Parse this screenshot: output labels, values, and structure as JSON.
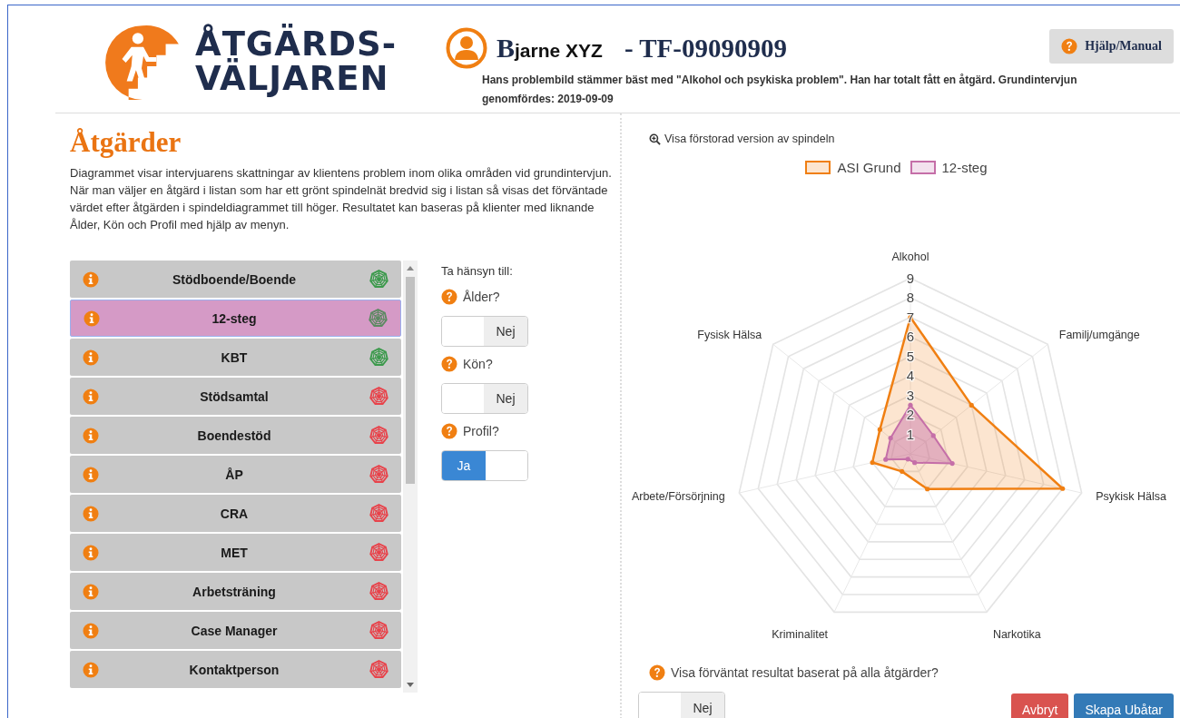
{
  "header": {
    "logo_lines": [
      "ÅTGÄRDS-",
      "VÄLJAREN"
    ],
    "client_name": "Bjarne XYZ",
    "client_id": "- TF-09090909",
    "summary": "Hans problembild stämmer bäst med \"Alkohol och psykiska problem\". Han har totalt fått en åtgärd. Grundintervjun genomfördes: 2019-09-09",
    "help_button": "Hjälp/Manual"
  },
  "main": {
    "title": "Åtgärder",
    "description": "Diagrammet visar intervjuarens skattningar av klientens problem inom olika områden vid grundintervjun. När man väljer en åtgärd i listan som har ett grönt spindelnät bredvid sig i listan så visas det förväntade värdet efter åtgärden i spindeldiagrammet till höger. Resultatet kan baseras på klienter med liknande Ålder, Kön och Profil med hjälp av menyn."
  },
  "measures": [
    {
      "label": "Stödboende/Boende",
      "selected": false,
      "color": "#3c9a4c"
    },
    {
      "label": "12-steg",
      "selected": true,
      "color": "#5c8a62"
    },
    {
      "label": "KBT",
      "selected": false,
      "color": "#3c9a4c"
    },
    {
      "label": "Stödsamtal",
      "selected": false,
      "color": "#e8434b"
    },
    {
      "label": "Boendestöd",
      "selected": false,
      "color": "#e8434b"
    },
    {
      "label": "ÅP",
      "selected": false,
      "color": "#e8434b"
    },
    {
      "label": "CRA",
      "selected": false,
      "color": "#e8434b"
    },
    {
      "label": "MET",
      "selected": false,
      "color": "#e8434b"
    },
    {
      "label": "Arbetsträning",
      "selected": false,
      "color": "#e8434b"
    },
    {
      "label": "Case Manager",
      "selected": false,
      "color": "#e8434b"
    },
    {
      "label": "Kontaktperson",
      "selected": false,
      "color": "#e8434b"
    }
  ],
  "filters": {
    "title": "Ta hänsyn till:",
    "items": [
      {
        "label": "Ålder?",
        "on": false,
        "value": "Nej"
      },
      {
        "label": "Kön?",
        "on": false,
        "value": "Nej"
      },
      {
        "label": "Profil?",
        "on": true,
        "value": "Ja"
      }
    ]
  },
  "spider": {
    "zoom_link": "Visa förstorad version av spindeln",
    "axes": [
      "Alkohol",
      "Familj/umgänge",
      "Psykisk Hälsa",
      "Narkotika",
      "Kriminalitet",
      "Arbete/Försörjning",
      "Fysisk Hälsa"
    ],
    "scale": [
      "9",
      "8",
      "7",
      "6",
      "5",
      "4",
      "3",
      "2",
      "1"
    ],
    "series": [
      {
        "name": "ASI Grund",
        "color": "#f07f12"
      },
      {
        "name": "12-steg",
        "color": "#c56fa8"
      }
    ]
  },
  "footer": {
    "question": "Visa förväntat resultat baserat på alla åtgärder?",
    "toggle": {
      "on": false,
      "value": "Nej"
    },
    "buttons": [
      {
        "label": "Avbryt",
        "kind": "danger"
      },
      {
        "label": "Skapa Ubåtar",
        "kind": "primary"
      }
    ]
  }
}
